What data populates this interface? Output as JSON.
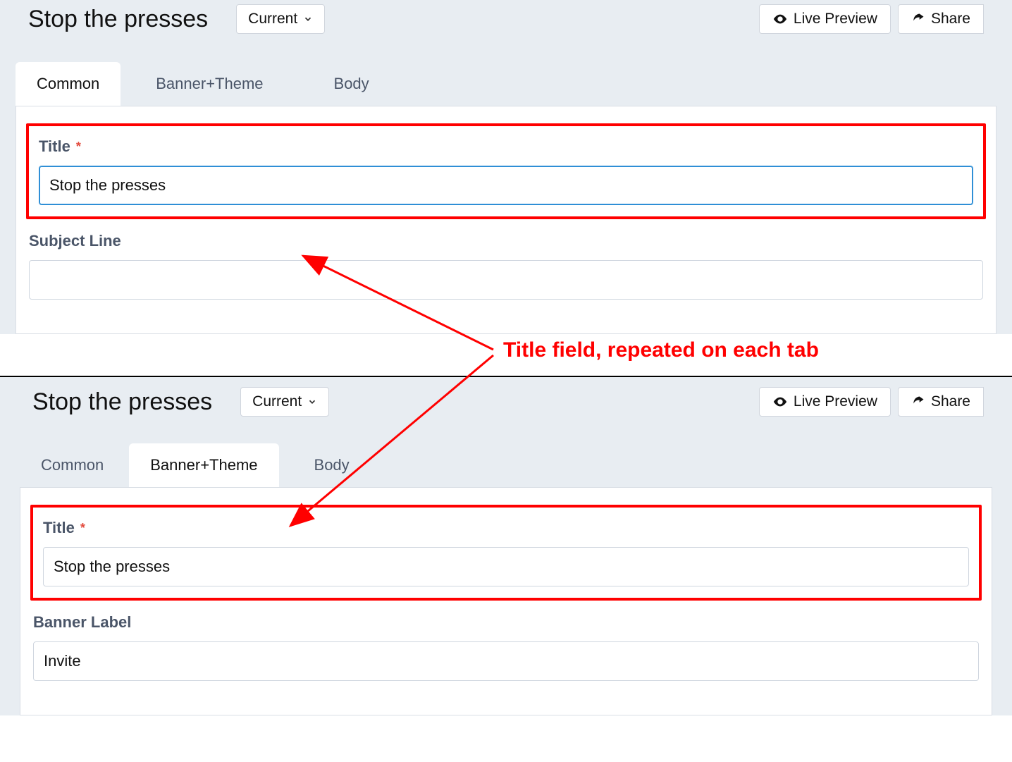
{
  "page_title": "Stop the presses",
  "version_selector": {
    "label": "Current"
  },
  "actions": {
    "preview": "Live Preview",
    "share": "Share"
  },
  "tabs": {
    "common": "Common",
    "banner_theme": "Banner+Theme",
    "body": "Body"
  },
  "common_form": {
    "title_label": "Title",
    "title_value": "Stop the presses",
    "subject_label": "Subject Line",
    "subject_value": ""
  },
  "banner_form": {
    "title_label": "Title",
    "title_value": "Stop the presses",
    "banner_label_label": "Banner Label",
    "banner_label_value": "Invite"
  },
  "annotation": {
    "text": "Title field, repeated on each tab"
  },
  "colors": {
    "page_bg": "#e8edf2",
    "highlight": "#ff0000",
    "border": "#cfd6df",
    "text_muted": "#4a5568"
  }
}
